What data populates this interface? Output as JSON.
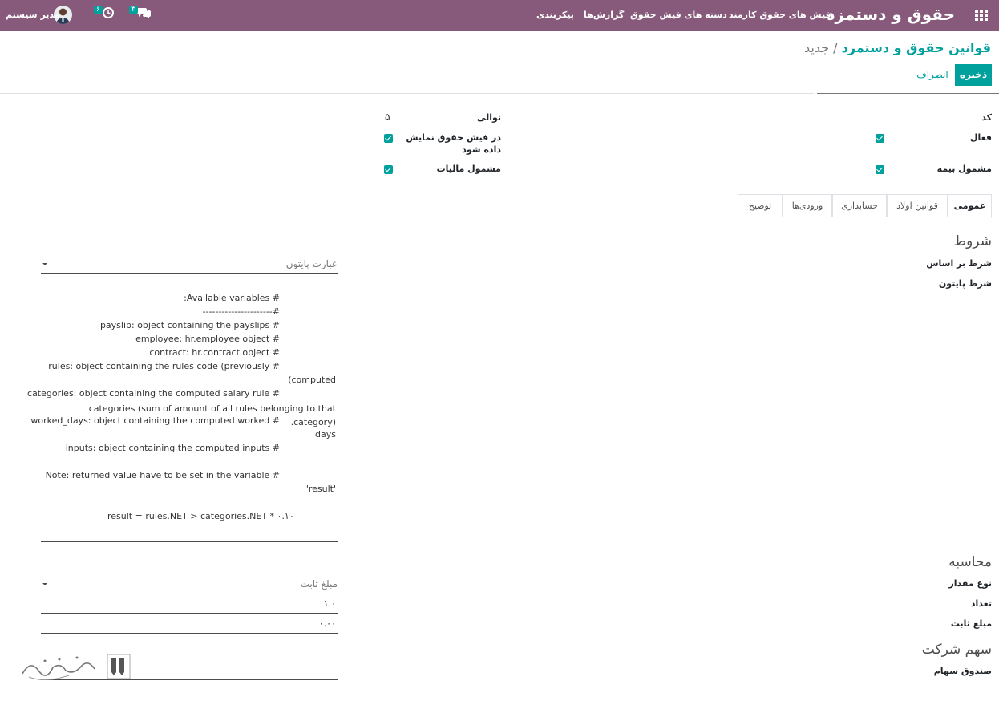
{
  "navbar": {
    "brand": "حقوق و دستمزد",
    "menu": [
      {
        "label": "فیش های حقوق کارمند"
      },
      {
        "label": "دسته های فیش حقوق"
      },
      {
        "label": "گزارش‌ها"
      },
      {
        "label": "پیکربندی"
      }
    ],
    "chat_badge": "۳",
    "activity_badge": "۶",
    "user_name": "مدیر سیستم",
    "apps_icon": "grid-icon",
    "chat_icon": "chat-icon",
    "activity_icon": "clock-icon"
  },
  "breadcrumb": {
    "parent": "قوانین حقوق و دستمزد",
    "separator": "/",
    "current": "جدید"
  },
  "actions": {
    "save": "ذخیره",
    "discard": "انصراف"
  },
  "fields": {
    "code_label": "کد",
    "code_value": "",
    "sequence_label": "توالی",
    "sequence_value": "۵",
    "active_label": "فعال",
    "show_in_payslip_label_line1": "در فیش حقوق نمایش",
    "show_in_payslip_label_line2": "داده شود",
    "insurance_label": "مشمول بیمه",
    "tax_label": "مشمول مالیات"
  },
  "tabs": [
    {
      "label": "عمومی",
      "active": true
    },
    {
      "label": "قوانین اولاد",
      "active": false
    },
    {
      "label": "حسابداری",
      "active": false
    },
    {
      "label": "ورودی‌ها",
      "active": false
    },
    {
      "label": "توضیح",
      "active": false
    }
  ],
  "conditions": {
    "title": "شروط",
    "based_on_label": "شرط بر اساس",
    "based_on_value": "عبارت پایتون",
    "python_label": "شرط پایتون",
    "python_code": [
      "# Available variables:",
      "#----------------------",
      "# payslip: object containing the payslips",
      "# employee: hr.employee object",
      "# contract: hr.contract object",
      "# rules: object containing the rules code (previously",
      "computed)",
      "# categories: object containing the computed salary rule",
      "categories (sum of amount of all rules belonging to that category).",
      "# worked_days: object containing the computed worked",
      "days",
      "# inputs: object containing the computed inputs",
      "",
      "# Note: returned value have to be set in the variable",
      "'result'",
      "",
      "result = rules.NET > categories.NET * ۰.۱۰"
    ]
  },
  "computation": {
    "title": "محاسبه",
    "amount_type_label": "نوع مقدار",
    "amount_type_value": "مبلغ ثابت",
    "quantity_label": "تعداد",
    "quantity_value": "۱.۰",
    "fixed_amount_label": "مبلغ ثابت",
    "fixed_amount_value": "۰.۰۰"
  },
  "company": {
    "title": "سهم شرکت",
    "fund_label": "صندوق سهام",
    "fund_value": ""
  },
  "colors": {
    "navbar": "#875a7b",
    "accent": "#00a09d"
  }
}
